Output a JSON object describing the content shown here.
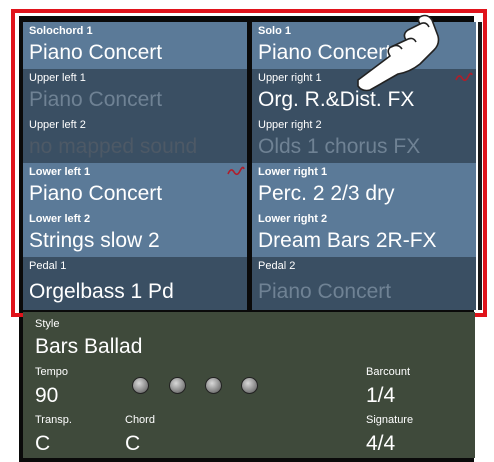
{
  "sounds": {
    "left": [
      {
        "label": "Solochord 1",
        "value": "Piano Concert",
        "label_bold": true,
        "state": "active"
      },
      {
        "label": "Upper left 1",
        "value": "Piano Concert",
        "label_bold": false,
        "state": "dim"
      },
      {
        "label": "Upper left 2",
        "value": "no mapped sound",
        "label_bold": false,
        "state": "dim"
      },
      {
        "label": "Lower left 1",
        "value": "Piano Concert",
        "label_bold": true,
        "state": "active"
      },
      {
        "label": "Lower left 2",
        "value": "Strings slow 2",
        "label_bold": true,
        "state": "active"
      },
      {
        "label": "Pedal 1",
        "value": "Orgelbass 1  Pd",
        "label_bold": false,
        "state": "active"
      }
    ],
    "right": [
      {
        "label": "Solo 1",
        "value": "Piano Concert",
        "label_bold": true,
        "state": "active"
      },
      {
        "label": "Upper right 1",
        "value": "Org. R.&Dist. FX",
        "label_bold": false,
        "state": "active"
      },
      {
        "label": "Upper right 2",
        "value": "Olds 1 chorus FX",
        "label_bold": false,
        "state": "dim"
      },
      {
        "label": "Lower right 1",
        "value": "Perc. 2 2/3 dry",
        "label_bold": true,
        "state": "active"
      },
      {
        "label": "Lower right 2",
        "value": "Dream Bars 2R-FX",
        "label_bold": true,
        "state": "active"
      },
      {
        "label": "Pedal 2",
        "value": "Piano Concert",
        "label_bold": false,
        "state": "dim"
      }
    ]
  },
  "style": {
    "label": "Style",
    "value": "Bars Ballad"
  },
  "tempo": {
    "label": "Tempo",
    "value": "90"
  },
  "transp": {
    "label": "Transp.",
    "value": "C"
  },
  "chord": {
    "label": "Chord",
    "value": "C"
  },
  "barcount": {
    "label": "Barcount",
    "value": "1/4"
  },
  "signature": {
    "label": "Signature",
    "value": "4/4"
  },
  "beat_indicator_count": 4,
  "colors": {
    "highlight_frame": "#e0131b",
    "cell_light": "#5b7a98",
    "cell_dark": "#3a4f63",
    "panel": "#3f4a3b",
    "wave_marker": "#b01e2a"
  },
  "icons": [
    "pointing-hand-icon",
    "wave-marker-icon"
  ]
}
